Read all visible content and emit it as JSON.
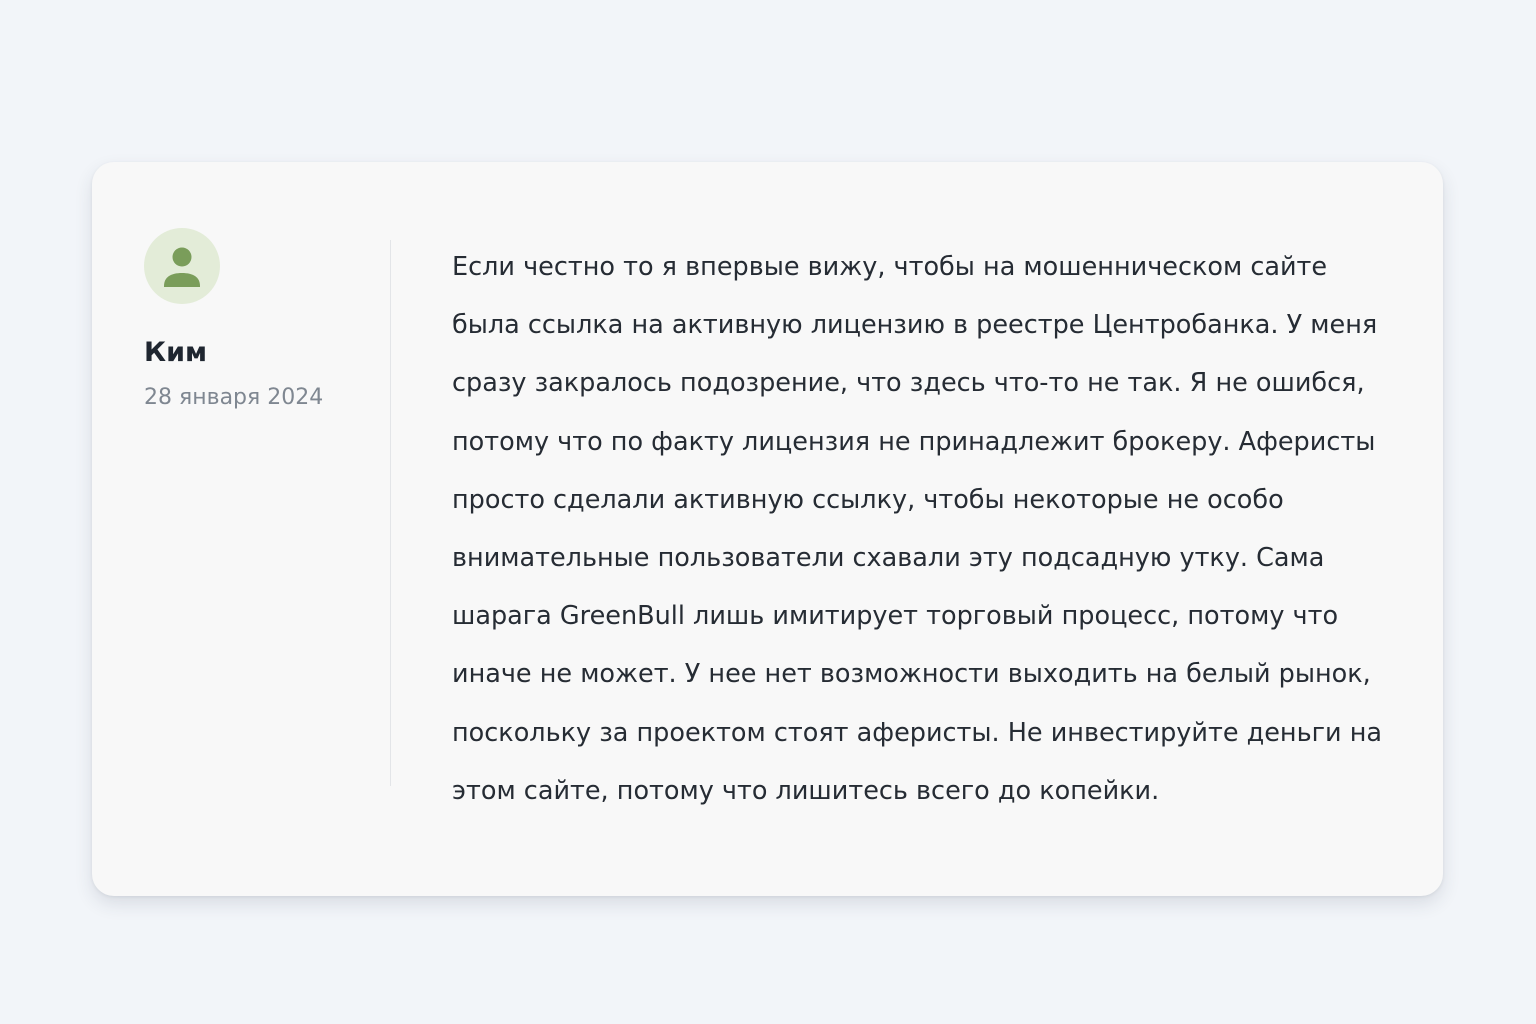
{
  "review": {
    "author": {
      "name": "Ким",
      "avatar_icon": "user-icon",
      "avatar_color": "#7a9d5a",
      "avatar_bg": "#e3ecd8"
    },
    "date": "28 января 2024",
    "text_lines": [
      "Если честно то я впервые вижу, чтобы на мошенническом сайте",
      "была ссылка на активную лицензию в реестре Центробанка. У меня",
      "сразу закралось подозрение, что здесь что-то не так. Я не ошибся,",
      "потому что по факту лицензия не принадлежит брокеру. Аферисты",
      "просто сделали активную ссылку, чтобы некоторые не особо",
      "внимательные пользователи схавали эту подсадную утку. Сама",
      "шарага GreenBull лишь имитирует торговый процесс, потому что",
      "иначе не может. У нее нет возможности выходить на белый рынок,",
      "поскольку за проектом стоят аферисты. Не инвестируйте деньги на",
      "этом сайте, потому что лишитесь всего до копейки."
    ]
  }
}
